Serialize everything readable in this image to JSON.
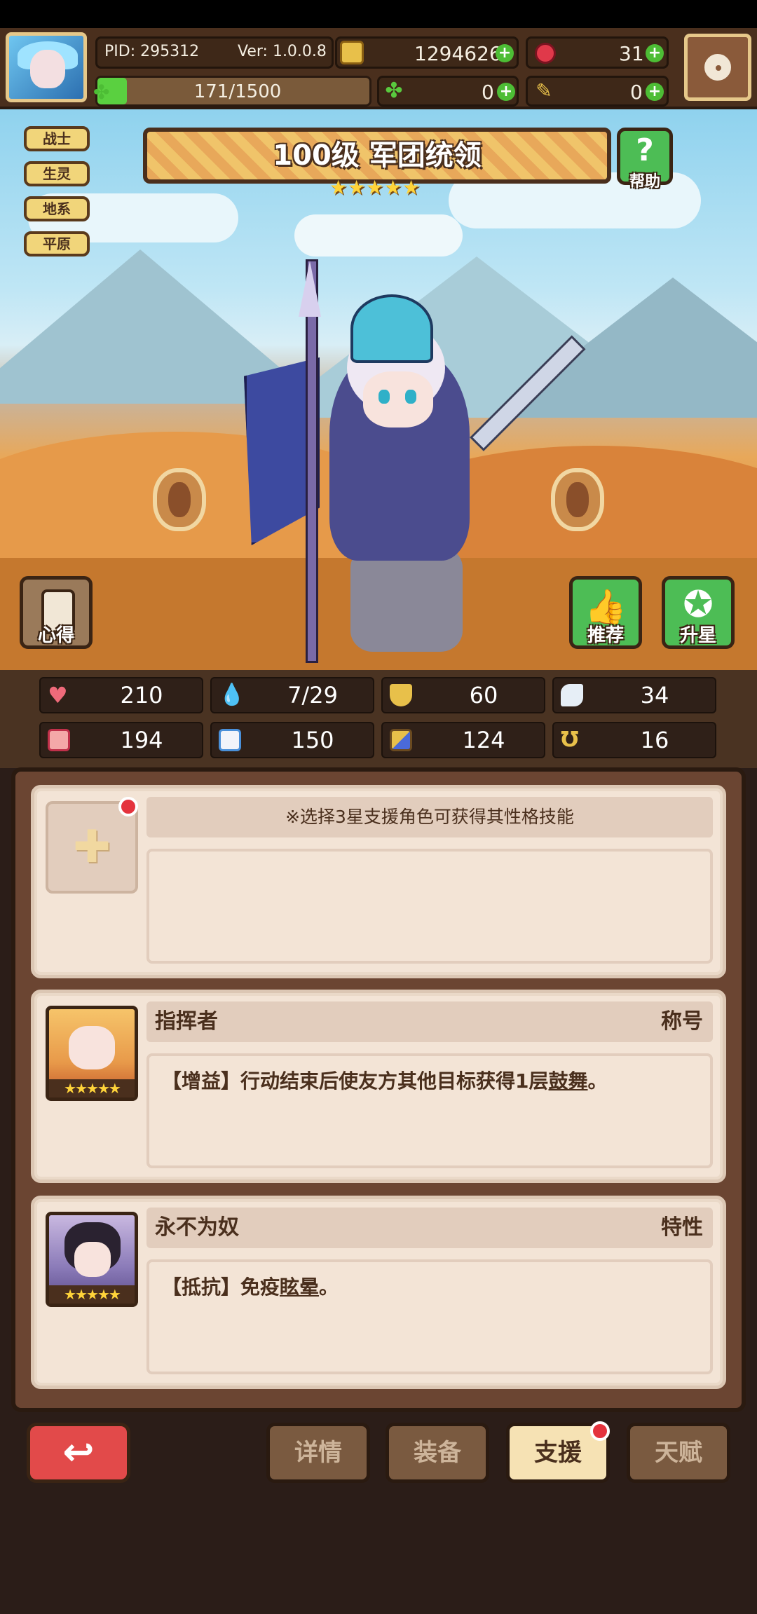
{
  "header": {
    "pid": "PID: 295312",
    "version": "Ver: 1.0.0.8",
    "gold": "1294626",
    "gems": "31",
    "stamina": "171/1500",
    "clover": "0",
    "hammer": "0"
  },
  "tags": [
    "战士",
    "生灵",
    "地系",
    "平原"
  ],
  "character": {
    "title": "100级  军团统领",
    "stars": 5
  },
  "buttons": {
    "help": "帮助",
    "insight": "心得",
    "recommend": "推荐",
    "star_up": "升星"
  },
  "stats": [
    {
      "icon": "heart-icon",
      "value": "210"
    },
    {
      "icon": "water-drop-icon",
      "value": "7/29"
    },
    {
      "icon": "shield-icon",
      "value": "60"
    },
    {
      "icon": "wing-icon",
      "value": "34"
    },
    {
      "icon": "fist-icon",
      "value": "194"
    },
    {
      "icon": "book-icon",
      "value": "150"
    },
    {
      "icon": "boot-icon",
      "value": "124"
    },
    {
      "icon": "horseshoe-icon",
      "value": "16"
    }
  ],
  "support": {
    "empty_hint": "※选择3星支援角色可获得其性格技能",
    "skills": [
      {
        "name": "指挥者",
        "type": "称号",
        "desc_pre": "【增益】行动结束后使友方其他目标获得1层",
        "desc_kw": "鼓舞",
        "desc_post": "。"
      },
      {
        "name": "永不为奴",
        "type": "特性",
        "desc_pre": "【抵抗】免疫",
        "desc_kw": "眩晕",
        "desc_post": "。"
      }
    ]
  },
  "tabs": {
    "details": "详情",
    "equipment": "装备",
    "support": "支援",
    "talent": "天赋"
  },
  "colors": {
    "accent_red": "#e24a4a",
    "panel_brown": "#6b4532",
    "card_bg": "#f3e4d6",
    "star_gold": "#ffd43a"
  }
}
